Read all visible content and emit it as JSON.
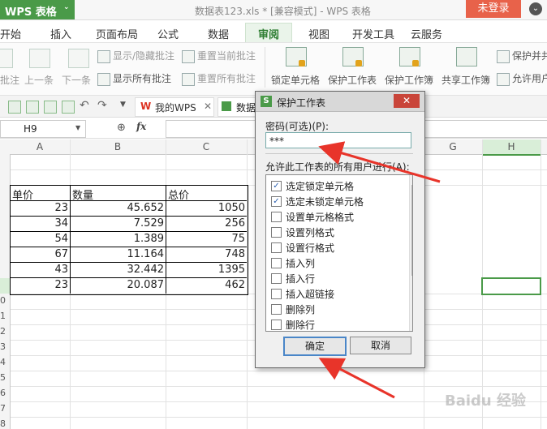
{
  "app": {
    "name": "WPS 表格",
    "dropdown": "⌄"
  },
  "window_title": "数据表123.xls * [兼容模式] - WPS 表格",
  "login_label": "未登录",
  "menu_tabs": [
    "开始",
    "插入",
    "页面布局",
    "公式",
    "数据",
    "审阅",
    "视图",
    "开发工具",
    "云服务"
  ],
  "ribbon": {
    "comment_prev_partial": "批注",
    "prev": "上一条",
    "next": "下一条",
    "show_hide_comment": "显示/隐藏批注",
    "show_all_comments": "显示所有批注",
    "reset_current_comment": "重置当前批注",
    "reset_all_comments": "重置所有批注",
    "lock_cell": "锁定单元格",
    "protect_sheet": "保护工作表",
    "protect_workbook": "保护工作簿",
    "share_workbook": "共享工作簿",
    "protect_share_partial": "保护并共",
    "allow_users_partial": "允许用户"
  },
  "file_tabs": {
    "my_wps": "我的WPS",
    "data_partial": "数据"
  },
  "formula_bar": {
    "cell_ref": "H9",
    "fx": "fx",
    "value": ""
  },
  "columns": [
    "A",
    "B",
    "C",
    "G",
    "H"
  ],
  "row_numbers": [
    "0",
    "1",
    "2",
    "3",
    "4",
    "5",
    "6",
    "7",
    "8",
    "9"
  ],
  "table": {
    "headers": [
      "单价",
      "数量",
      "总价"
    ],
    "rows": [
      [
        "23",
        "45.652",
        "1050"
      ],
      [
        "34",
        "7.529",
        "256"
      ],
      [
        "54",
        "1.389",
        "75"
      ],
      [
        "67",
        "11.164",
        "748"
      ],
      [
        "43",
        "32.442",
        "1395"
      ],
      [
        "23",
        "20.087",
        "462"
      ]
    ]
  },
  "dialog": {
    "title": "保护工作表",
    "close": "✕",
    "password_label": "密码(可选)(P):",
    "password_value": "***",
    "permissions_label": "允许此工作表的所有用户进行(A):",
    "permissions": [
      {
        "label": "选定锁定单元格",
        "checked": true
      },
      {
        "label": "选定未锁定单元格",
        "checked": true
      },
      {
        "label": "设置单元格格式",
        "checked": false
      },
      {
        "label": "设置列格式",
        "checked": false
      },
      {
        "label": "设置行格式",
        "checked": false
      },
      {
        "label": "插入列",
        "checked": false
      },
      {
        "label": "插入行",
        "checked": false
      },
      {
        "label": "插入超链接",
        "checked": false
      },
      {
        "label": "删除列",
        "checked": false
      },
      {
        "label": "删除行",
        "checked": false
      }
    ],
    "ok": "确定",
    "cancel": "取消"
  },
  "colors": {
    "accent_green": "#4a9a48",
    "arrow_red": "#e8342a",
    "login_orange": "#e8624a"
  },
  "watermark": "Baidu 经验"
}
